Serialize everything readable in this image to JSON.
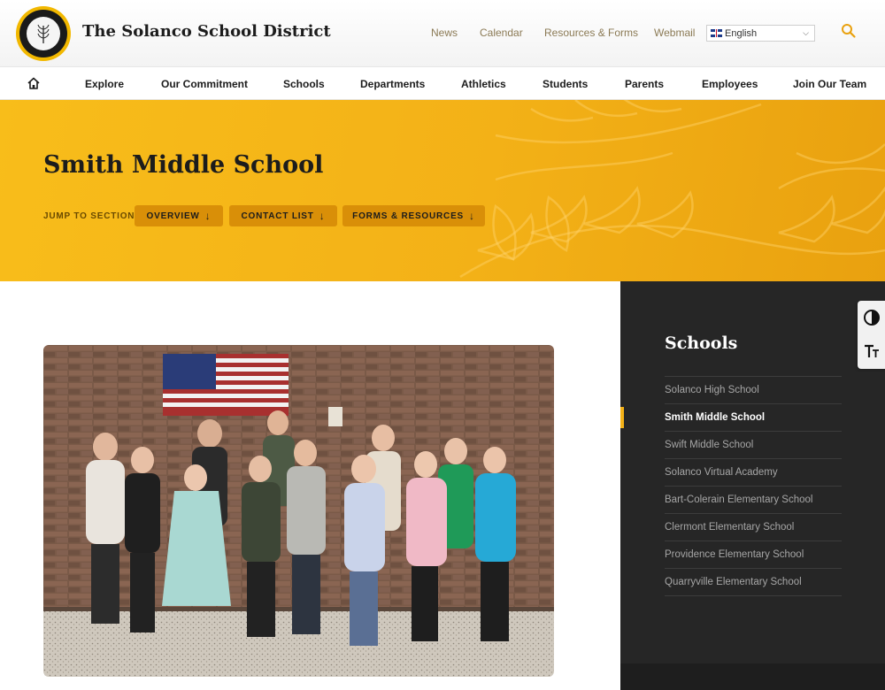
{
  "header": {
    "district_name": "The Solanco School District",
    "utility_links": [
      "News",
      "Calendar",
      "Resources & Forms",
      "Webmail"
    ],
    "language": "English"
  },
  "nav": {
    "items": [
      "Explore",
      "Our Commitment",
      "Schools",
      "Departments",
      "Athletics",
      "Students",
      "Parents",
      "Employees",
      "Join Our Team"
    ]
  },
  "hero": {
    "title": "Smith Middle School",
    "jump_label": "JUMP TO SECTION:",
    "jump_buttons": [
      "OVERVIEW",
      "CONTACT LIST",
      "FORMS & RESOURCES"
    ]
  },
  "sidebar": {
    "title": "Schools",
    "items": [
      "Solanco High School",
      "Smith Middle School",
      "Swift Middle School",
      "Solanco Virtual Academy",
      "Bart-Colerain Elementary School",
      "Clermont Elementary School",
      "Providence Elementary School",
      "Quarryville Elementary School"
    ],
    "active_index": 1
  },
  "colors": {
    "accent": "#f3b117",
    "button": "#d98f08",
    "sidebar_bg": "#262626"
  },
  "icons": {
    "home": "home-icon",
    "search": "search-icon",
    "contrast": "contrast-icon",
    "text_size": "text-size-icon"
  }
}
